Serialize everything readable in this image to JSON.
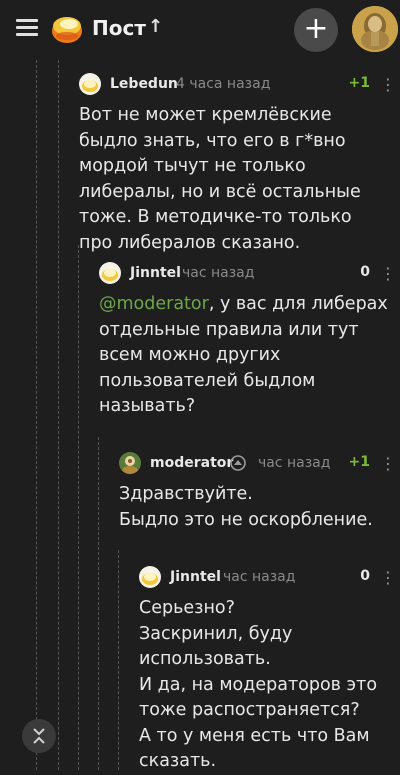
{
  "header": {
    "title": "Пост",
    "up_arrow": "↑",
    "plus": "+"
  },
  "comments": [
    {
      "author": "Lebedun",
      "time": "4 часа назад",
      "score": "+1",
      "score_color": "#7cba3c",
      "text": "Вот не может кремлёвские быдло знать, что его в г*вно мордой тычут не только либералы, но и всё остальные тоже. В методичке-то только про либералов сказано."
    },
    {
      "author": "Jinntel",
      "time": "час назад",
      "score": "0",
      "score_color": "#e8e8e8",
      "mention": "@moderator",
      "text": ", у вас для либерах отдельные правила или тут всем можно других пользователей быдлом называть?"
    },
    {
      "author": "moderator",
      "time": "час назад",
      "score": "+1",
      "score_color": "#7cba3c",
      "text": "Здравствуйте.\nБыдло это не оскорбление."
    },
    {
      "author": "Jinntel",
      "time": "час назад",
      "score": "0",
      "score_color": "#e8e8e8",
      "text": "Серьезно?\nЗаскринил, буду использовать.\nИ да, на модераторов это тоже распостраняется?\nА то у меня есть что Вам сказать."
    }
  ],
  "icons": {
    "menu": "hamburger-icon",
    "logo": "pikabu-logo-icon",
    "more": "more-vertical-icon",
    "collapse": "collapse-icon",
    "moderator_badge": "shield-icon"
  },
  "colors": {
    "background": "#1e1e1e",
    "positive_score": "#7cba3c",
    "mention": "#6ca84a"
  }
}
